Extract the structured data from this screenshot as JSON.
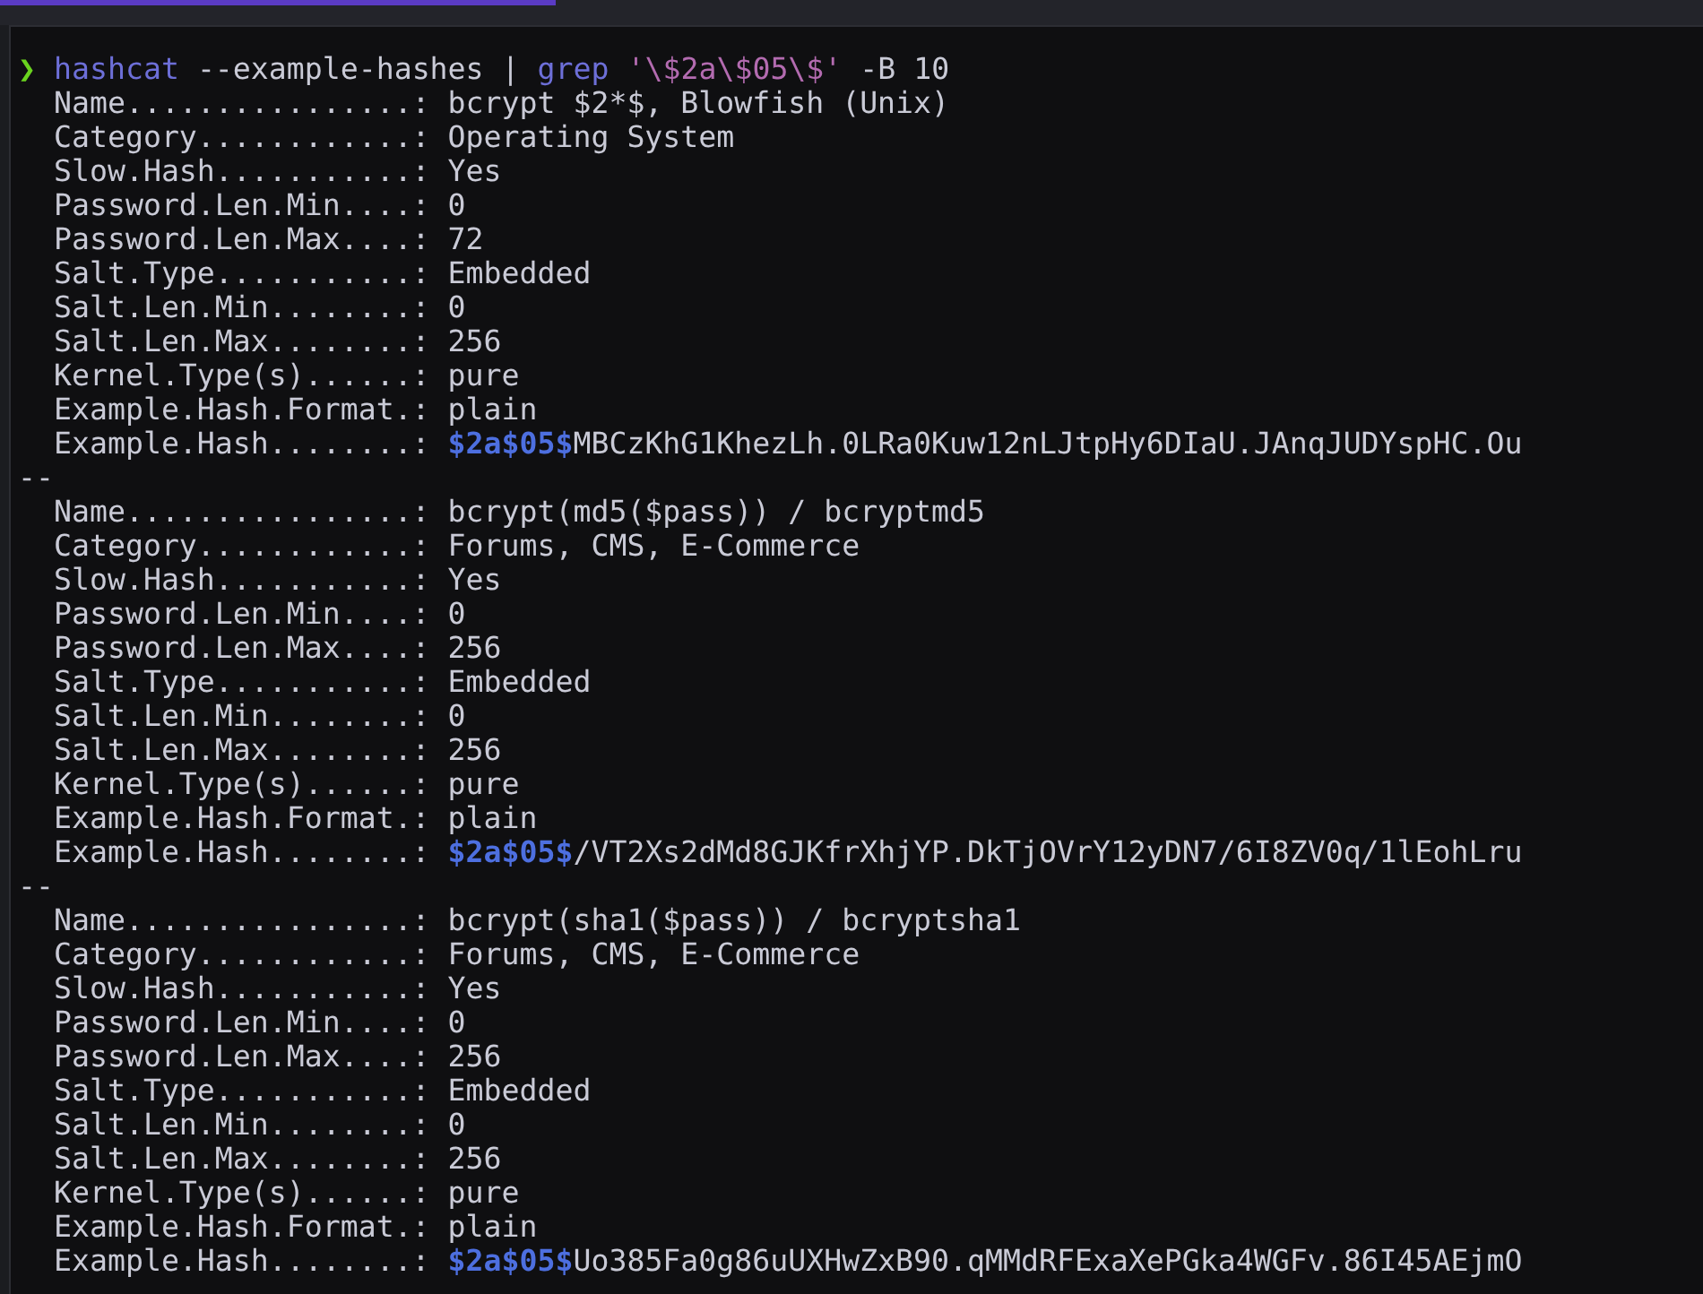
{
  "prompt": {
    "symbol": "❯",
    "tokens": [
      {
        "kind": "program",
        "text": "hashcat"
      },
      {
        "kind": "arg",
        "text": "--example-hashes"
      },
      {
        "kind": "arg",
        "text": "|"
      },
      {
        "kind": "program",
        "text": "grep"
      },
      {
        "kind": "string",
        "text": "'\\$2a\\$05\\$'"
      },
      {
        "kind": "arg",
        "text": "-B 10"
      }
    ]
  },
  "blocks": [
    {
      "fields": [
        {
          "label": "Name................:",
          "value": "bcrypt $2*$, Blowfish (Unix)"
        },
        {
          "label": "Category............:",
          "value": "Operating System"
        },
        {
          "label": "Slow.Hash...........:",
          "value": "Yes"
        },
        {
          "label": "Password.Len.Min....:",
          "value": "0"
        },
        {
          "label": "Password.Len.Max....:",
          "value": "72"
        },
        {
          "label": "Salt.Type...........:",
          "value": "Embedded"
        },
        {
          "label": "Salt.Len.Min........:",
          "value": "0"
        },
        {
          "label": "Salt.Len.Max........:",
          "value": "256"
        },
        {
          "label": "Kernel.Type(s)......:",
          "value": "pure"
        },
        {
          "label": "Example.Hash.Format.:",
          "value": "plain"
        }
      ],
      "example_hash": {
        "label": "Example.Hash........:",
        "match": "$2a$05$",
        "rest": "MBCzKhG1KhezLh.0LRa0Kuw12nLJtpHy6DIaU.JAnqJUDYspHC.Ou"
      },
      "separator": "--"
    },
    {
      "fields": [
        {
          "label": "Name................:",
          "value": "bcrypt(md5($pass)) / bcryptmd5"
        },
        {
          "label": "Category............:",
          "value": "Forums, CMS, E-Commerce"
        },
        {
          "label": "Slow.Hash...........:",
          "value": "Yes"
        },
        {
          "label": "Password.Len.Min....:",
          "value": "0"
        },
        {
          "label": "Password.Len.Max....:",
          "value": "256"
        },
        {
          "label": "Salt.Type...........:",
          "value": "Embedded"
        },
        {
          "label": "Salt.Len.Min........:",
          "value": "0"
        },
        {
          "label": "Salt.Len.Max........:",
          "value": "256"
        },
        {
          "label": "Kernel.Type(s)......:",
          "value": "pure"
        },
        {
          "label": "Example.Hash.Format.:",
          "value": "plain"
        }
      ],
      "example_hash": {
        "label": "Example.Hash........:",
        "match": "$2a$05$",
        "rest": "/VT2Xs2dMd8GJKfrXhjYP.DkTjOVrY12yDN7/6I8ZV0q/1lEohLru"
      },
      "separator": "--"
    },
    {
      "fields": [
        {
          "label": "Name................:",
          "value": "bcrypt(sha1($pass)) / bcryptsha1"
        },
        {
          "label": "Category............:",
          "value": "Forums, CMS, E-Commerce"
        },
        {
          "label": "Slow.Hash...........:",
          "value": "Yes"
        },
        {
          "label": "Password.Len.Min....:",
          "value": "0"
        },
        {
          "label": "Password.Len.Max....:",
          "value": "256"
        },
        {
          "label": "Salt.Type...........:",
          "value": "Embedded"
        },
        {
          "label": "Salt.Len.Min........:",
          "value": "0"
        },
        {
          "label": "Salt.Len.Max........:",
          "value": "256"
        },
        {
          "label": "Kernel.Type(s)......:",
          "value": "pure"
        },
        {
          "label": "Example.Hash.Format.:",
          "value": "plain"
        }
      ],
      "example_hash": {
        "label": "Example.Hash........:",
        "match": "$2a$05$",
        "rest": "Uo385Fa0g86uUXHwZxB90.qMMdRFExaXePGka4WGFv.86I45AEjmO"
      }
    }
  ]
}
